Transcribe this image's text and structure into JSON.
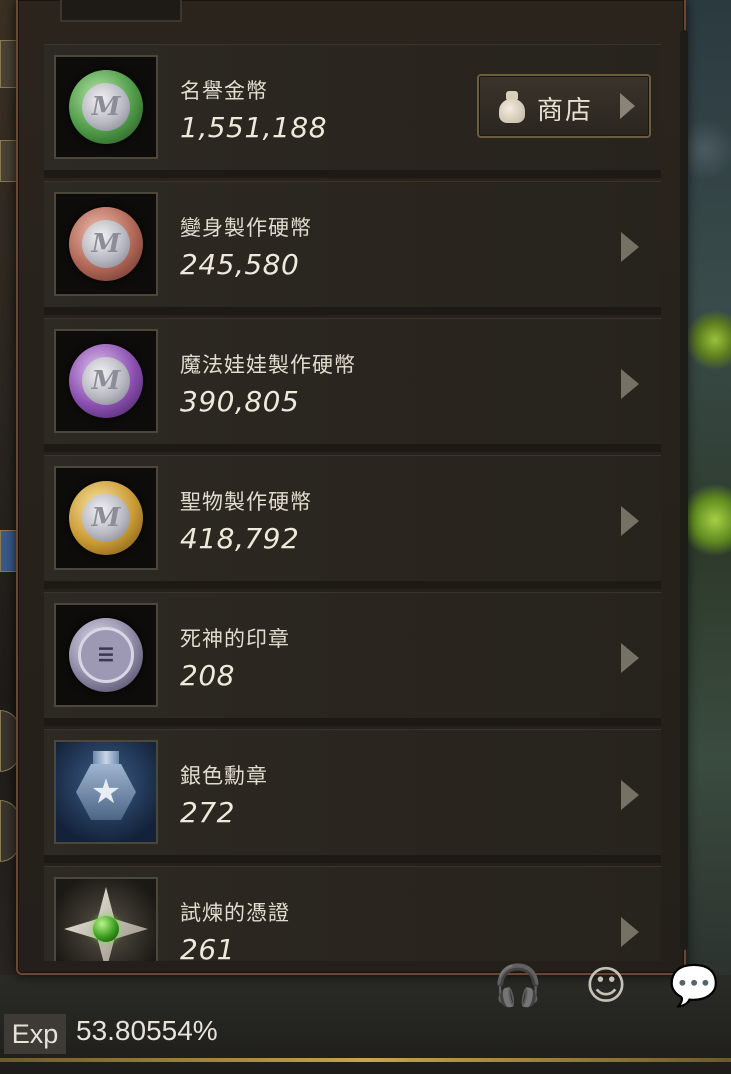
{
  "currency_list": {
    "shop_label": "商店",
    "items": [
      {
        "name": "名譽金幣",
        "value": "1,551,188",
        "icon": "green-coin-icon"
      },
      {
        "name": "變身製作硬幣",
        "value": "245,580",
        "icon": "copper-coin-icon"
      },
      {
        "name": "魔法娃娃製作硬幣",
        "value": "390,805",
        "icon": "purple-coin-icon"
      },
      {
        "name": "聖物製作硬幣",
        "value": "418,792",
        "icon": "gold-coin-icon"
      },
      {
        "name": "死神的印章",
        "value": "208",
        "icon": "reaper-seal-icon"
      },
      {
        "name": "銀色勳章",
        "value": "272",
        "icon": "silver-medal-icon"
      },
      {
        "name": "試煉的憑證",
        "value": "261",
        "icon": "trial-token-icon"
      }
    ]
  },
  "hud": {
    "exp_label": "Exp",
    "exp_value": "53.80554%",
    "icons": [
      "headset-icon",
      "emoji-icon",
      "chat-icon"
    ]
  },
  "colors": {
    "panel_border": "#6a4733",
    "row_bg": "#2d2923",
    "text": "#e2dccf"
  }
}
